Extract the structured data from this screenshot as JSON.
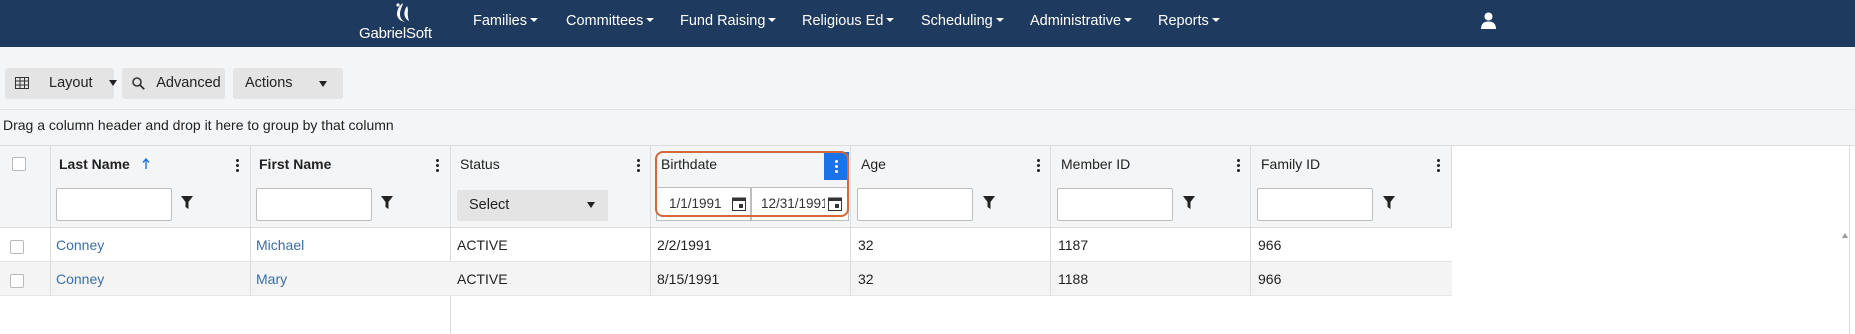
{
  "nav": {
    "logo": "GabrielSoft",
    "items": [
      {
        "label": "Families"
      },
      {
        "label": "Committees"
      },
      {
        "label": "Fund Raising"
      },
      {
        "label": "Religious Ed"
      },
      {
        "label": "Scheduling"
      },
      {
        "label": "Administrative"
      },
      {
        "label": "Reports"
      }
    ],
    "user_icon": "user-icon"
  },
  "toolbar": {
    "layout_label": "Layout",
    "advanced_label": "Advanced",
    "actions_label": "Actions"
  },
  "group_hint": "Drag a column header and drop it here to group by that column",
  "grid": {
    "columns": [
      {
        "label": "Last Name",
        "sorted": "ascending"
      },
      {
        "label": "First Name"
      },
      {
        "label": "Status"
      },
      {
        "label": "Birthdate"
      },
      {
        "label": "Age"
      },
      {
        "label": "Member ID"
      },
      {
        "label": "Family ID"
      }
    ],
    "filters": {
      "status_select": "Select",
      "birthdate_from": "1/1/1991",
      "birthdate_to": "12/31/1991"
    },
    "rows": [
      {
        "last_name": "Conney",
        "first_name": "Michael",
        "status": "ACTIVE",
        "birthdate": "2/2/1991",
        "age": "32",
        "member_id": "1187",
        "family_id": "966"
      },
      {
        "last_name": "Conney",
        "first_name": "Mary",
        "status": "ACTIVE",
        "birthdate": "8/15/1991",
        "age": "32",
        "member_id": "1188",
        "family_id": "966"
      }
    ]
  },
  "colors": {
    "nav_bg": "#1f3a5f",
    "link": "#3a6ea5",
    "highlight_outline": "#d2693a",
    "active_menu": "#1a73e8"
  }
}
